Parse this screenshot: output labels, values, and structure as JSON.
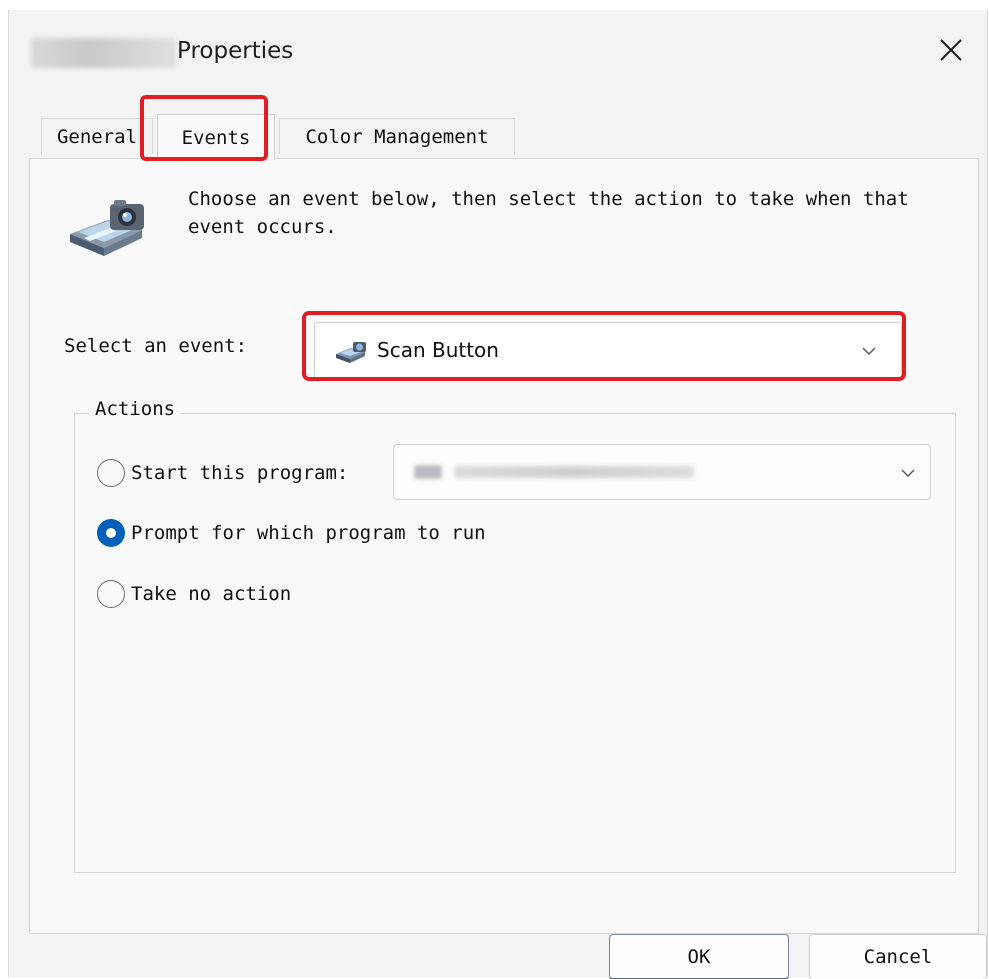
{
  "window": {
    "title": "Properties",
    "close_glyph": "✕"
  },
  "tabs": [
    {
      "label": "General",
      "selected": false
    },
    {
      "label": "Events",
      "selected": true
    },
    {
      "label": "Color Management",
      "selected": false
    }
  ],
  "events_panel": {
    "icon": "scanner-camera-icon",
    "intro_line1": "Choose an event below, then select the action to take when that",
    "intro_line2": "event occurs.",
    "select_event_label": "Select an event:",
    "selected_event": "Scan Button",
    "selected_event_icon": "scanner-icon"
  },
  "actions": {
    "legend": "Actions",
    "options": [
      {
        "label": "Start this program:",
        "selected": false
      },
      {
        "label": "Prompt for which program to run",
        "selected": true
      },
      {
        "label": "Take no action",
        "selected": false
      }
    ]
  },
  "buttons": {
    "ok": "OK",
    "cancel": "Cancel"
  },
  "colors": {
    "highlight": "#e31d24",
    "accent": "#005fb8"
  }
}
